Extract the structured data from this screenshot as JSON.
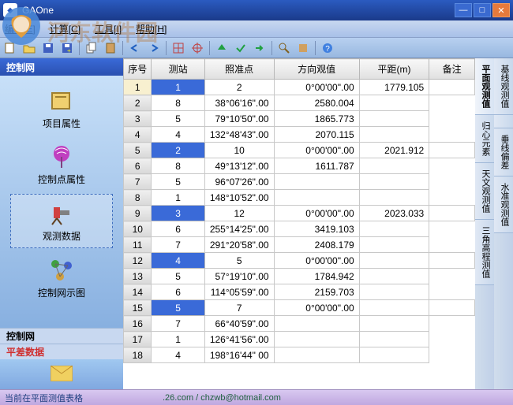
{
  "window": {
    "title": "GAOne"
  },
  "menu": [
    "编辑[E]",
    "计算[C]",
    "工具[I]",
    "帮助[H]"
  ],
  "watermark": "河东软件园",
  "sidebar": {
    "header": "控制网",
    "items": [
      {
        "label": "项目属性",
        "icon": "📋"
      },
      {
        "label": "控制点属性",
        "icon": "📡"
      },
      {
        "label": "观测数据",
        "icon": "🔭"
      },
      {
        "label": "控制网示图",
        "icon": "🔗"
      }
    ],
    "section2": "控制网",
    "section3": "平差数据"
  },
  "grid": {
    "headers": [
      "序号",
      "测站",
      "照准点",
      "方向观值",
      "平距(m)",
      "备注"
    ],
    "stations": [
      {
        "num": "1",
        "rows": [
          {
            "rh": "1",
            "pt": "2",
            "dir": "0°00'00\".00",
            "dist": "1779.105",
            "note": ""
          },
          {
            "rh": "2",
            "pt": "8",
            "dir": "38°06'16\".00",
            "dist": "2580.004",
            "note": ""
          },
          {
            "rh": "3",
            "pt": "5",
            "dir": "79°10'50\".00",
            "dist": "1865.773",
            "note": ""
          },
          {
            "rh": "4",
            "pt": "4",
            "dir": "132°48'43\".00",
            "dist": "2070.115",
            "note": ""
          }
        ]
      },
      {
        "num": "2",
        "rows": [
          {
            "rh": "5",
            "pt": "10",
            "dir": "0°00'00\".00",
            "dist": "2021.912",
            "note": ""
          },
          {
            "rh": "6",
            "pt": "8",
            "dir": "49°13'12\".00",
            "dist": "1611.787",
            "note": ""
          },
          {
            "rh": "7",
            "pt": "5",
            "dir": "96°07'26\".00",
            "dist": "",
            "note": ""
          },
          {
            "rh": "8",
            "pt": "1",
            "dir": "148°10'52\".00",
            "dist": "",
            "note": ""
          }
        ]
      },
      {
        "num": "3",
        "rows": [
          {
            "rh": "9",
            "pt": "12",
            "dir": "0°00'00\".00",
            "dist": "2023.033",
            "note": ""
          },
          {
            "rh": "10",
            "pt": "6",
            "dir": "255°14'25\".00",
            "dist": "3419.103",
            "note": ""
          },
          {
            "rh": "11",
            "pt": "7",
            "dir": "291°20'58\".00",
            "dist": "2408.179",
            "note": ""
          }
        ]
      },
      {
        "num": "4",
        "rows": [
          {
            "rh": "12",
            "pt": "5",
            "dir": "0°00'00\".00",
            "dist": "",
            "note": ""
          },
          {
            "rh": "13",
            "pt": "5",
            "dir": "57°19'10\".00",
            "dist": "1784.942",
            "note": ""
          },
          {
            "rh": "14",
            "pt": "6",
            "dir": "114°05'59\".00",
            "dist": "2159.703",
            "note": ""
          }
        ]
      },
      {
        "num": "5",
        "rows": [
          {
            "rh": "15",
            "pt": "7",
            "dir": "0°00'00\".00",
            "dist": "",
            "note": ""
          },
          {
            "rh": "16",
            "pt": "7",
            "dir": "66°40'59\".00",
            "dist": "",
            "note": ""
          },
          {
            "rh": "17",
            "pt": "1",
            "dir": "126°41'56\".00",
            "dist": "",
            "note": ""
          },
          {
            "rh": "18",
            "pt": "4",
            "dir": "198°16'44\" 00",
            "dist": "",
            "note": ""
          }
        ]
      }
    ]
  },
  "righttabs": {
    "col1": [
      "平面观测值",
      "归心元素",
      "天文观测值",
      "三角高程测值"
    ],
    "col2": [
      "基线观测值",
      "",
      "垂线偏差",
      "水准观测值"
    ]
  },
  "status": {
    "left": "当前在平面测值表格",
    "right": ".26.com / chzwb@hotmail.com"
  }
}
